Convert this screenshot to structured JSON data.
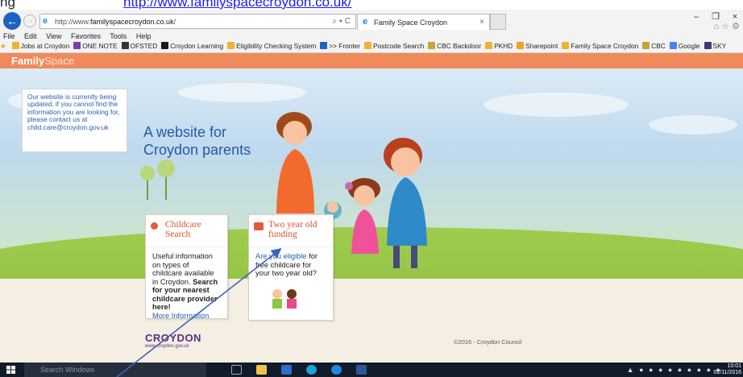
{
  "caption": {
    "prefix": "ng",
    "link": "http://www.familyspacecroydon.co.uk/"
  },
  "browser": {
    "url_prefix": "http://www.",
    "url_domain": "familyspacecroydon.co.uk",
    "url_suffix": "/",
    "address_tools": "⌕ ▾ C",
    "tab_title": "Family Space Croydon",
    "menu": [
      "File",
      "Edit",
      "View",
      "Favorites",
      "Tools",
      "Help"
    ],
    "favorites": [
      {
        "label": "Jobs at Croydon",
        "color": "#f2b134"
      },
      {
        "label": "ONE NOTE",
        "color": "#7a3ea8"
      },
      {
        "label": "OFSTED",
        "color": "#333333"
      },
      {
        "label": "Croydon Learning",
        "color": "#1a1a1a"
      },
      {
        "label": "Eligibility Checking System",
        "color": "#f2b134"
      },
      {
        "label": ">> Fronter",
        "color": "#1d63c4"
      },
      {
        "label": "Postcode Search",
        "color": "#f2b134"
      },
      {
        "label": "CBC Backdoor",
        "color": "#c9a23a"
      },
      {
        "label": "PKHD",
        "color": "#f2b134"
      },
      {
        "label": "Sharepoint",
        "color": "#f0a22e"
      },
      {
        "label": "Family Space Croydon",
        "color": "#f2b134"
      },
      {
        "label": "CBC",
        "color": "#c9a23a"
      },
      {
        "label": "Google",
        "color": "#4285f4"
      },
      {
        "label": "SKY",
        "color": "#3a3a7a"
      }
    ]
  },
  "site": {
    "logo_a": "Family",
    "logo_b": "Space",
    "notice": "Our website is currently being updated, if you cannot find the information you are looking for, please contact us at child.care@croydon.gov.uk",
    "hero_line1": "A website for",
    "hero_line2": "Croydon parents",
    "card1": {
      "title": "Childcare Search",
      "text": "Useful information on types of childcare available in Croydon.",
      "bold": "Search for your nearest childcare provider here!",
      "more": "More Information"
    },
    "card2": {
      "title_line1": "Two year old",
      "title_line2": "funding",
      "link": "Are you eligible",
      "text": "for free childcare for your two year old?"
    },
    "footer_logo": "CROYDON",
    "footer_sub": "www.croydon.gov.uk",
    "copyright": "©2016 - Croydon Council"
  },
  "taskbar": {
    "search_placeholder": "Search Windows",
    "time": "10:01",
    "date": "02/11/2016"
  },
  "colors": {
    "accent": "#f08a5a",
    "link": "#2460b8",
    "grass": "#9fcc4e"
  }
}
